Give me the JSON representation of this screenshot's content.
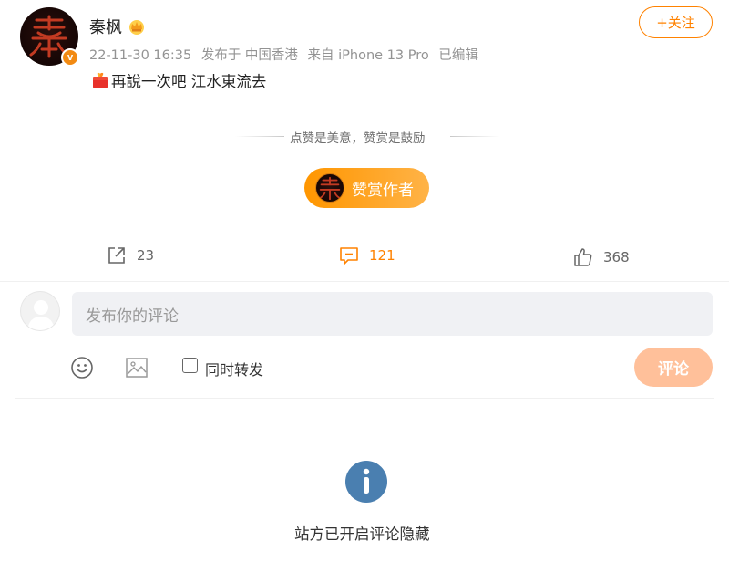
{
  "post": {
    "username": "秦枫",
    "timestamp": "22-11-30 16:35",
    "location": "发布于 中国香港",
    "device": "来自 iPhone 13 Pro",
    "edited": "已编辑",
    "text": "再說一次吧 江水東流去"
  },
  "follow_button": {
    "label": "+关注"
  },
  "reward": {
    "hint": "点赞是美意，赞赏是鼓励",
    "button_label": "赞赏作者"
  },
  "actions": {
    "forward_count": "23",
    "comment_count": "121",
    "like_count": "368"
  },
  "comment_box": {
    "placeholder": "发布你的评论",
    "repost_label": "同时转发",
    "submit_label": "评论"
  },
  "notice": {
    "text": "站方已开启评论隐藏"
  },
  "colors": {
    "accent": "#ff8200",
    "info": "#4a7fb0",
    "submit_disabled": "#ffc09a"
  }
}
